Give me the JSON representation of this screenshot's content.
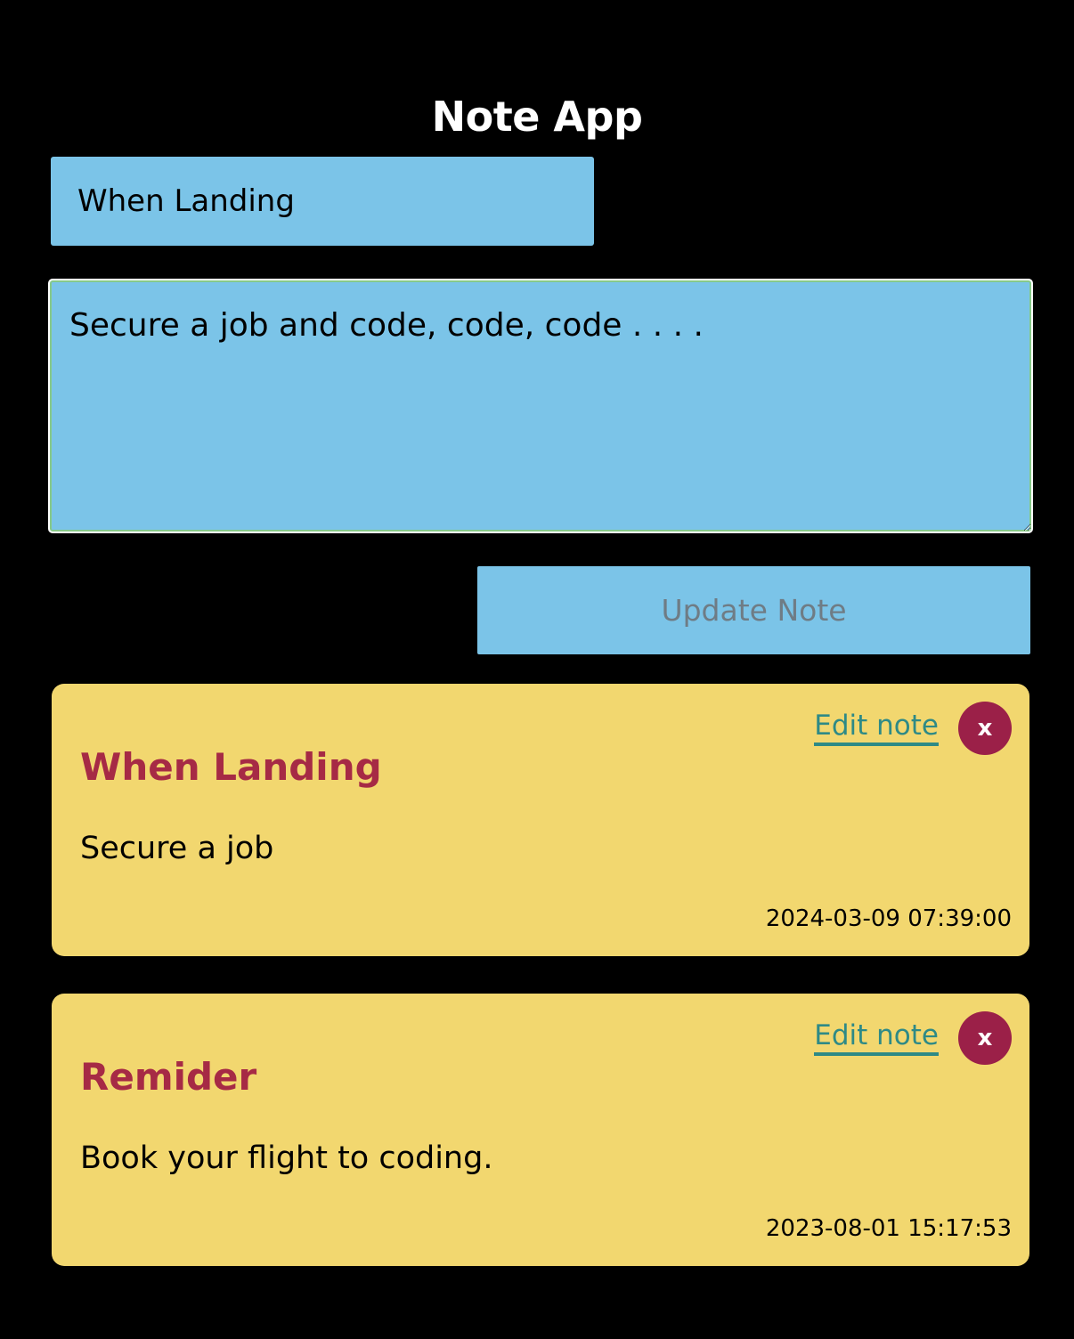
{
  "app": {
    "title": "Note App"
  },
  "form": {
    "title_value": "When Landing",
    "body_value": "Secure a job and code, code, code . . . .",
    "submit_label": "Update Note"
  },
  "notes": [
    {
      "title": "When Landing",
      "body": "Secure a job",
      "timestamp": "2024-03-09 07:39:00",
      "edit_label": "Edit note",
      "delete_label": "x"
    },
    {
      "title": "Remider",
      "body": "Book your flight to coding.",
      "timestamp": "2023-08-01 15:17:53",
      "edit_label": "Edit note",
      "delete_label": "x"
    }
  ],
  "colors": {
    "background": "#000000",
    "input_fill": "#7bc4e8",
    "card_fill": "#f2d76f",
    "note_title": "#a62a45",
    "edit_link": "#2e8a86",
    "delete_button": "#9b2048"
  }
}
